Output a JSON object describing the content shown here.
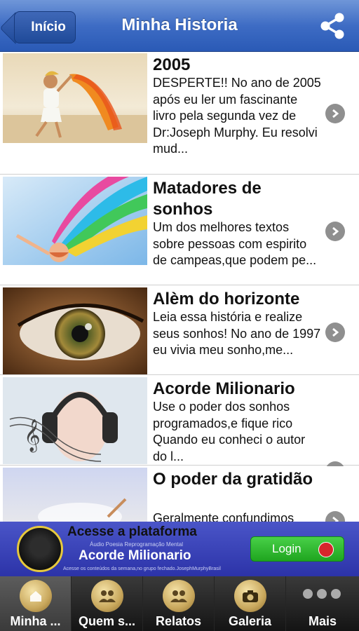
{
  "navbar": {
    "back_label": "Início",
    "title": "Minha Historia"
  },
  "stories": [
    {
      "title": "2005",
      "description": "DESPERTE!! No ano de 2005 após eu ler um fascinante livro pela segunda vez de Dr:Joseph Murphy. Eu resolvi mud..."
    },
    {
      "title": "Matadores de sonhos",
      "description": "Um dos melhores textos sobre pessoas com espirito de campeas,que podem pe..."
    },
    {
      "title": "Alèm do horizonte",
      "description": "Leia essa história e realize seus sonhos! No ano de 1997 eu vivia meu sonho,me..."
    },
    {
      "title": "Acorde Milionario",
      "description": "Use o poder dos sonhos programados,e fique rico Quando eu conheci o autor do l..."
    },
    {
      "title": "O poder da gratidão",
      "description": "Geralmente confundimos"
    }
  ],
  "banner": {
    "title": "Acesse a plataforma",
    "subtitle_small": "Áudio Poesia Reprogramação Mental",
    "main_text": "Acorde Milionario",
    "footer_small": "Acesse os conteúdos da semana,no grupo fechado.JosephMurphyBrasil",
    "login_label": "Login"
  },
  "tabs": [
    {
      "label": "Minha ...",
      "icon": "home-icon",
      "active": true
    },
    {
      "label": "Quem s...",
      "icon": "group-icon",
      "active": false
    },
    {
      "label": "Relatos",
      "icon": "people-icon",
      "active": false
    },
    {
      "label": "Galeria",
      "icon": "camera-icon",
      "active": false
    },
    {
      "label": "Mais",
      "icon": "more-icon",
      "active": false
    }
  ],
  "colors": {
    "navbar": "#3e6cc4",
    "banner": "#3a42b8",
    "login": "#2db82d",
    "tabbar": "#1e1e1e"
  }
}
